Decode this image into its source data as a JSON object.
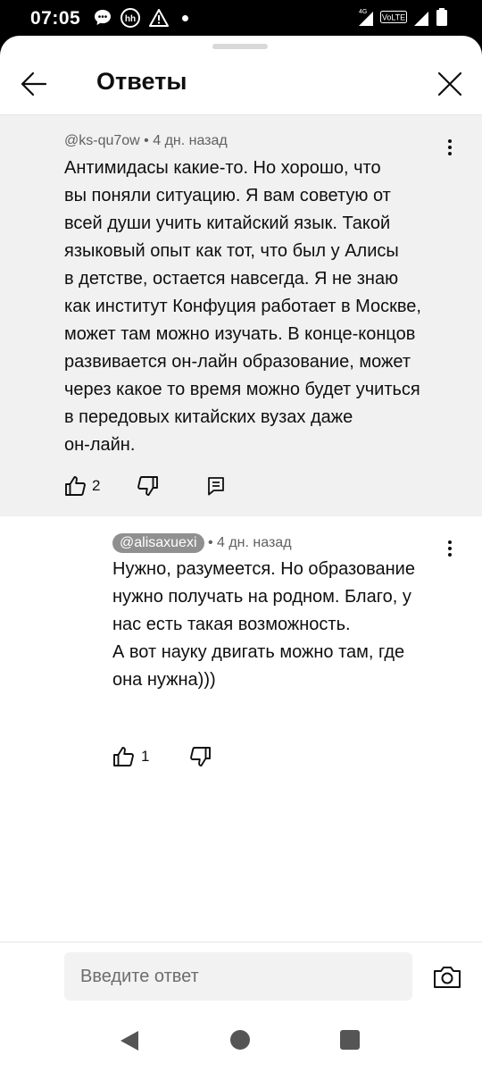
{
  "status_bar": {
    "time": "07:05",
    "network": "4G",
    "volte": "VoLTE",
    "left_icons": [
      "chat-bubble-icon",
      "hh-icon",
      "warning-icon",
      "dot-icon"
    ],
    "right_icons": [
      "signal-icon",
      "volte-icon",
      "signal-icon",
      "battery-icon"
    ]
  },
  "header": {
    "title": "Ответы",
    "back_icon": "arrow-left-icon",
    "close_icon": "close-icon"
  },
  "parent_comment": {
    "author": "@ks-qu7ow",
    "time": "4 дн. назад",
    "text": "Антимидасы какие-то. Но хорошо, что\nвы поняли ситуацию.  Я вам советую от\nвсей души учить китайский язык. Такой\nязыковый опыт как тот, что был у Алисы\nв детстве, остается навсегда. Я не знаю\nкак институт Конфуция работает в Москве,\nможет там можно изучать. В конце-концов\nразвивается он-лайн образование, может\nчерез какое то время можно будет учиться\nв передовых китайских вузах даже\nон-лайн.",
    "likes": "2"
  },
  "reply_comment": {
    "author": "@alisaxuexi",
    "time": "4 дн. назад",
    "text": "Нужно, разумеется. Но образование\nнужно получать на родном. Благо, у\nнас есть такая возможность.\nА вот науку двигать можно там, где\nона нужна)))",
    "likes": "1"
  },
  "reply_input": {
    "placeholder": "Введите ответ",
    "value": ""
  },
  "colors": {
    "parent_bg": "#f1f1f1",
    "meta_text": "#606060",
    "handle_chip": "#909090"
  }
}
